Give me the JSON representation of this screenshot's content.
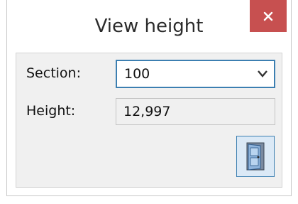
{
  "window": {
    "title": "View height",
    "close_icon": "close-icon",
    "close_color": "#c75050"
  },
  "form": {
    "section_label": "Section:",
    "section_value": "100",
    "height_label": "Height:",
    "height_value": "12,997"
  },
  "actions": {
    "door_icon": "exit-door-icon"
  },
  "colors": {
    "accent": "#3c7fb1",
    "panel": "#f0f0f0"
  }
}
